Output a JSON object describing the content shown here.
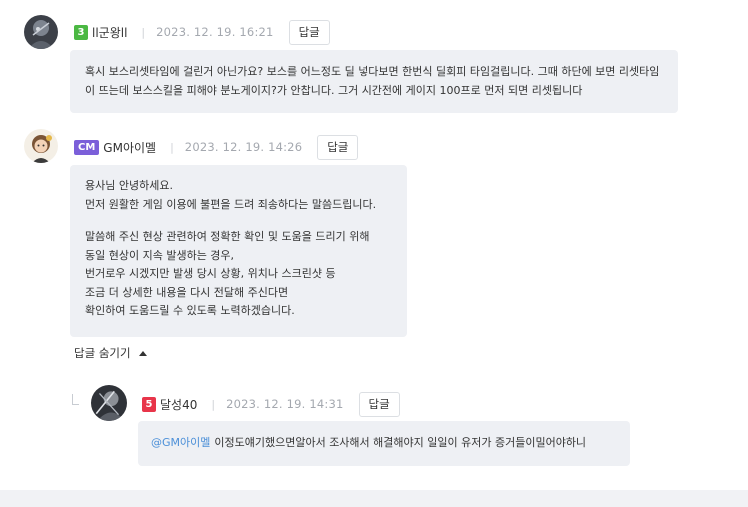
{
  "comments": [
    {
      "level": "3",
      "level_color": "#4bb843",
      "name": "ll군왕ll",
      "date": "2023. 12. 19. 16:21",
      "reply_label": "답글",
      "body": "혹시 보스리셋타임에 걸린거 아닌가요? 보스를 어느정도 딜 넣다보면 한번식 딜회피 타임걸립니다. 그때 하단에 보면 리셋타임이 뜨는데 보스스킬을 피해야 분노게이지?가 안찹니다. 그거 시간전에 게이지 100프로 먼저 되면 리셋됩니다"
    },
    {
      "level": "CM",
      "level_color": "#7b5fd9",
      "name": "GM아이멜",
      "date": "2023. 12. 19. 14:26",
      "reply_label": "답글",
      "lines": [
        "용사님 안녕하세요.",
        "먼저 원활한 게임 이용에 불편을 드려 죄송하다는 말씀드립니다.",
        "",
        "말씀해 주신 현상 관련하여 정확한 확인 및 도움을 드리기 위해",
        "동일 현상이 지속 발생하는 경우,",
        "번거로우 시겠지만 발생 당시 상황, 위치나 스크린샷 등",
        "조금 더 상세한 내용을 다시 전달해 주신다면",
        "확인하여 도움드릴 수 있도록 노력하겠습니다."
      ],
      "toggle_label": "답글 숨기기"
    },
    {
      "level": "5",
      "level_color": "#e8354a",
      "name": "달성40",
      "date": "2023. 12. 19. 14:31",
      "reply_label": "답글",
      "mention": "@GM아이멜",
      "body": "이정도얘기했으면알아서 조사해서 해결해야지 일일이 유저가 증거들이밀어야하니"
    }
  ]
}
